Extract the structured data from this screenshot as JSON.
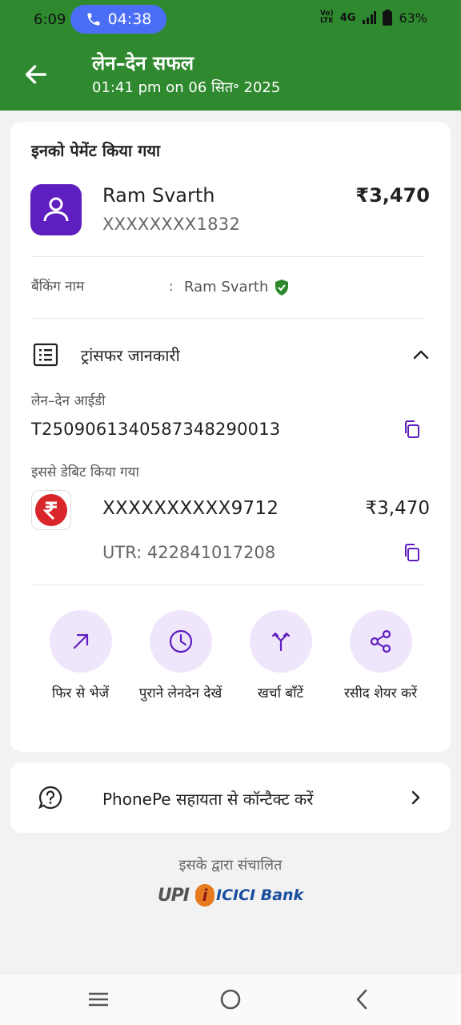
{
  "status_bar": {
    "time": "6:09",
    "call_timer": "04:38",
    "network_top": "Vo)",
    "network_bottom": "LTE",
    "network_type": "4G",
    "battery": "63%"
  },
  "header": {
    "title": "लेन–देन सफल",
    "subtitle": "01:41 pm on 06 सित॰ 2025",
    "bg_color": "#2f8a2f"
  },
  "payment": {
    "paid_to_label": "इनको पेमेंट किया गया",
    "payee_name": "Ram Svarth",
    "payee_account": "XXXXXXXX1832",
    "amount": "₹3,470",
    "banking_name_label": "बैंकिंग नाम",
    "banking_name_colon": ":",
    "banking_name_value": "Ram Svarth"
  },
  "transfer": {
    "section_title": "ट्रांसफर जानकारी",
    "txn_id_label": "लेन–देन आईडी",
    "txn_id": "T2509061340587348290013",
    "debited_from_label": "इससे डेबिट किया गया",
    "debit_account": "XXXXXXXXXX9712",
    "debit_amount": "₹3,470",
    "utr": "UTR: 422841017208"
  },
  "actions": [
    {
      "label": "फिर से भेजें",
      "icon": "arrow-up-right-icon"
    },
    {
      "label": "पुराने लेनदेन देखें",
      "icon": "clock-icon"
    },
    {
      "label": "खर्चा बाँटें",
      "icon": "split-icon"
    },
    {
      "label": "रसीद शेयर करें",
      "icon": "share-icon"
    }
  ],
  "help": {
    "label": "PhonePe सहायता से कॉन्टैक्ट करें"
  },
  "footer": {
    "powered_by": "इसके द्वारा संचालित",
    "upi_logo": "UPI",
    "bank_logo_text": "ICICI Bank"
  },
  "colors": {
    "accent_purple": "#5f1fc0",
    "action_bg": "#efe6fb",
    "verified_green": "#2f8a2f"
  }
}
